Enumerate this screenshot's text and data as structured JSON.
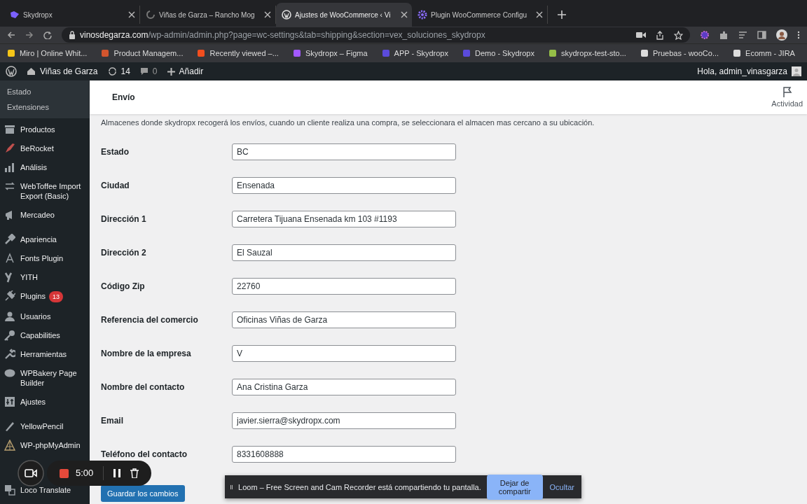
{
  "browser_tabs": [
    {
      "title": "Skydropx",
      "selected": false
    },
    {
      "title": "Viñas de Garza – Rancho Mog",
      "selected": false
    },
    {
      "title": "Ajustes de WooCommerce ‹ Vi",
      "selected": true
    },
    {
      "title": "Plugin WooCommerce Configu",
      "selected": false
    }
  ],
  "address_bar": {
    "host": "vinosdegarza.com",
    "path": "/wp-admin/admin.php?page=wc-settings&tab=shipping&section=vex_soluciones_skydropx"
  },
  "bookmarks": [
    "Miro | Online Whit...",
    "Product Managem...",
    "Recently viewed –...",
    "Skydropx – Figma",
    "APP - Skydropx",
    "Demo - Skydropx",
    "skydropx-test-sto...",
    "Pruebas - wooCo...",
    "Ecomm - JIRA"
  ],
  "admin_bar": {
    "site": "Viñas de Garza",
    "updates": "14",
    "comments": "0",
    "new": "Añadir",
    "greeting": "Hola, admin_vinasgarza"
  },
  "sidebar": {
    "submenu": [
      {
        "label": "Estado",
        "selected": false
      },
      {
        "label": "Extensiones",
        "selected": false
      }
    ],
    "menu_groups": [
      [
        {
          "label": "Productos"
        },
        {
          "label": "BeRocket"
        },
        {
          "label": "Análisis"
        },
        {
          "label": "WebToffee Import Export (Basic)"
        },
        {
          "label": "Mercadeo"
        }
      ],
      [
        {
          "label": "Apariencia"
        },
        {
          "label": "Fonts Plugin"
        },
        {
          "label": "YITH"
        },
        {
          "label": "Plugins",
          "badge": "13"
        },
        {
          "label": "Usuarios"
        },
        {
          "label": "Capabilities"
        },
        {
          "label": "Herramientas"
        },
        {
          "label": "WPBakery Page Builder"
        },
        {
          "label": "Ajustes"
        }
      ],
      [
        {
          "label": "YellowPencil"
        },
        {
          "label": "WP-phpMyAdmin"
        },
        {
          "label": "Loco Translate"
        }
      ]
    ]
  },
  "header": {
    "title": "Envío",
    "activity": "Actividad"
  },
  "description": "Almacenes donde skydropx recogerá los envíos, cuando un cliente realiza una compra, se seleccionara el almacen mas cercano a su ubicación.",
  "fields": [
    {
      "label": "Estado",
      "value": "BC"
    },
    {
      "label": "Ciudad",
      "value": "Ensenada"
    },
    {
      "label": "Dirección 1",
      "value": "Carretera Tijuana Ensenada km 103 #1193"
    },
    {
      "label": "Dirección 2",
      "value": "El Sauzal"
    },
    {
      "label": "Código Zip",
      "value": "22760"
    },
    {
      "label": "Referencia del comercio",
      "value": "Oficinas Viñas de Garza"
    },
    {
      "label": "Nombre de la empresa",
      "value": "V"
    },
    {
      "label": "Nombre del contacto",
      "value": "Ana Cristina Garza"
    },
    {
      "label": "Email",
      "value": "javier.sierra@skydropx.com"
    },
    {
      "label": "Teléfono del contacto",
      "value": "8331608888"
    }
  ],
  "save_button": "Guardar los cambios",
  "recorder": {
    "time": "5:00"
  },
  "share_bar": {
    "message": "Loom – Free Screen and Cam Recorder está compartiendo tu pantalla.",
    "stop": "Dejar de compartir",
    "hide": "Ocultar"
  }
}
